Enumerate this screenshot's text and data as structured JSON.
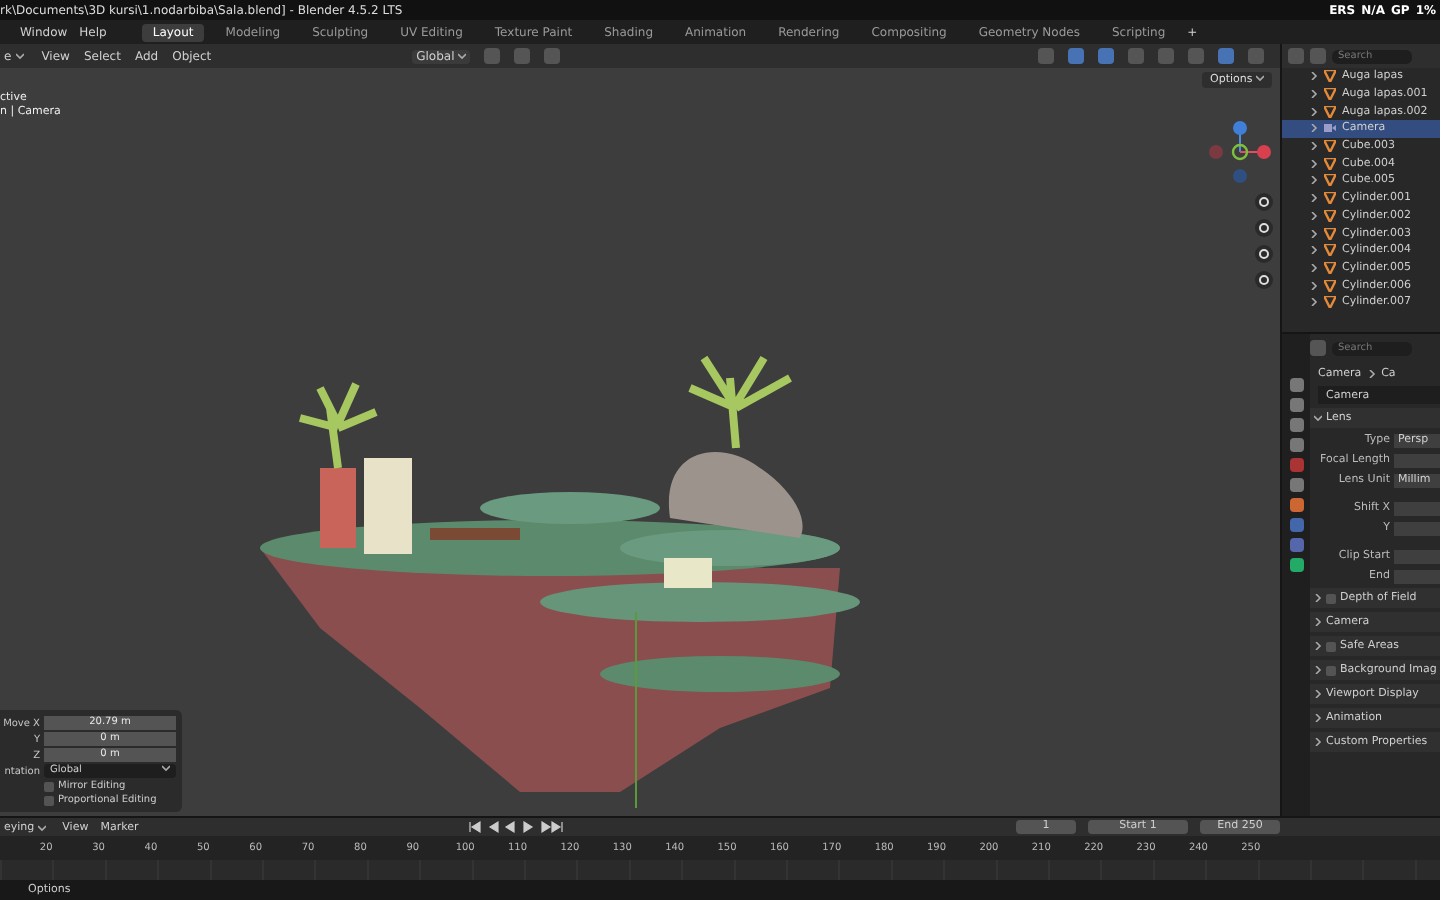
{
  "window": {
    "title": "rk\\Documents\\3D kursi\\1.nodarbiba\\Sala.blend] - Blender 4.5.2 LTS"
  },
  "stats": [
    "ERS",
    "N/A",
    "GP",
    "1%"
  ],
  "menu": [
    "Window",
    "Help"
  ],
  "workspaces": [
    {
      "label": "Layout",
      "selected": true
    },
    {
      "label": "Modeling",
      "selected": false
    },
    {
      "label": "Sculpting",
      "selected": false
    },
    {
      "label": "UV Editing",
      "selected": false
    },
    {
      "label": "Texture Paint",
      "selected": false
    },
    {
      "label": "Shading",
      "selected": false
    },
    {
      "label": "Animation",
      "selected": false
    },
    {
      "label": "Rendering",
      "selected": false
    },
    {
      "label": "Compositing",
      "selected": false
    },
    {
      "label": "Geometry Nodes",
      "selected": false
    },
    {
      "label": "Scripting",
      "selected": false
    }
  ],
  "add_tab": "+",
  "viewport_header": {
    "mode": "e",
    "menus": [
      "View",
      "Select",
      "Add",
      "Object"
    ],
    "orientation": "Global"
  },
  "viewport": {
    "info": [
      "ctive",
      "n | Camera"
    ],
    "options": "Options"
  },
  "operator_panel": {
    "fields": [
      {
        "label": "Move X",
        "value": "20.79 m"
      },
      {
        "label": "Y",
        "value": "0 m"
      },
      {
        "label": "Z",
        "value": "0 m"
      }
    ],
    "orientation_label": "ntation",
    "orientation": "Global",
    "checkboxes": [
      {
        "label": "Mirror Editing",
        "checked": false
      },
      {
        "label": "Proportional Editing",
        "checked": false
      }
    ]
  },
  "outliner": {
    "search_placeholder": "Search",
    "rows": [
      {
        "name": "Auga lapas",
        "selected": false
      },
      {
        "name": "Auga lapas.001",
        "selected": false
      },
      {
        "name": "Auga lapas.002",
        "selected": false
      },
      {
        "name": "Camera",
        "selected": true
      },
      {
        "name": "Cube.003",
        "selected": false
      },
      {
        "name": "Cube.004",
        "selected": false
      },
      {
        "name": "Cube.005",
        "selected": false
      },
      {
        "name": "Cylinder.001",
        "selected": false
      },
      {
        "name": "Cylinder.002",
        "selected": false
      },
      {
        "name": "Cylinder.003",
        "selected": false
      },
      {
        "name": "Cylinder.004",
        "selected": false
      },
      {
        "name": "Cylinder.005",
        "selected": false
      },
      {
        "name": "Cylinder.006",
        "selected": false
      },
      {
        "name": "Cylinder.007",
        "selected": false
      }
    ]
  },
  "properties": {
    "search_placeholder": "Search",
    "breadcrumb": [
      "Camera",
      "Ca"
    ],
    "datablock": "Camera",
    "lens_title": "Lens",
    "lens_fields": [
      {
        "label": "Type",
        "value": "Persp"
      },
      {
        "label": "Focal Length"
      },
      {
        "label": "Lens Unit",
        "value": "Millim"
      },
      {
        "label": "Shift X",
        "gap": true
      },
      {
        "label": "Y"
      },
      {
        "label": "Clip Start",
        "gap": true
      },
      {
        "label": "End"
      }
    ],
    "panels": [
      {
        "title": "Depth of Field",
        "checkbox": true
      },
      {
        "title": "Camera",
        "checkbox": false
      },
      {
        "title": "Safe Areas",
        "checkbox": true
      },
      {
        "title": "Background Imag",
        "checkbox": true
      },
      {
        "title": "Viewport Display",
        "checkbox": false
      },
      {
        "title": "Animation",
        "checkbox": false
      },
      {
        "title": "Custom Properties",
        "checkbox": false
      }
    ]
  },
  "timeline": {
    "mode": "eying",
    "menus": [
      "View",
      "Marker"
    ],
    "frame": "1",
    "start_label": "Start",
    "start": "1",
    "end_label": "End",
    "end": "250",
    "ticks": [
      "20",
      "30",
      "40",
      "50",
      "60",
      "70",
      "80",
      "90",
      "100",
      "110",
      "120",
      "130",
      "140",
      "150",
      "160",
      "170",
      "180",
      "190",
      "200",
      "210",
      "220",
      "230",
      "240",
      "250"
    ]
  },
  "status_bar": {
    "items": [
      "Options"
    ]
  }
}
